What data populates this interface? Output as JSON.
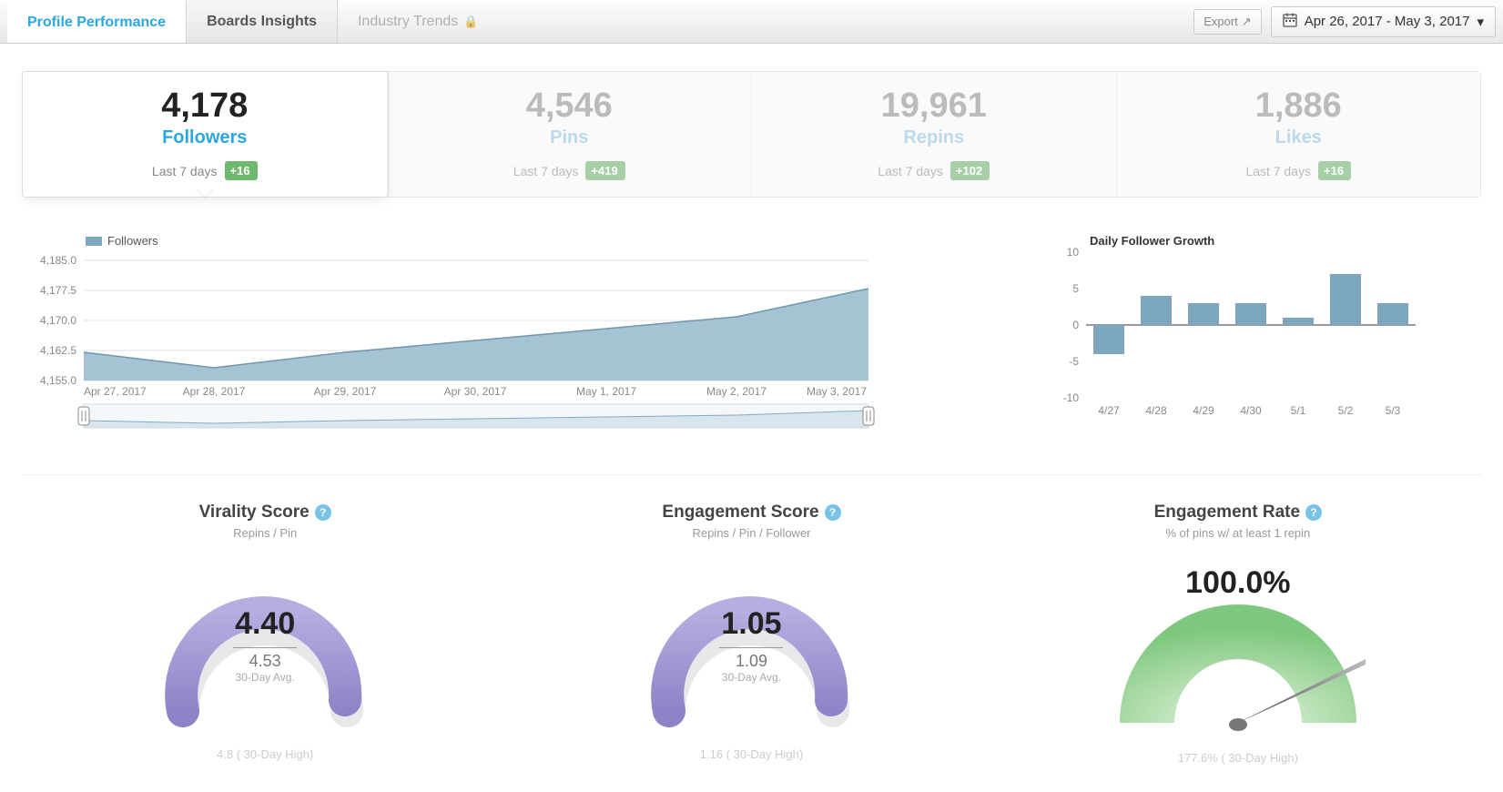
{
  "tabs": {
    "profile": "Profile Performance",
    "boards": "Boards Insights",
    "industry": "Industry Trends"
  },
  "export_label": "Export",
  "date_range": "Apr 26, 2017 - May 3, 2017",
  "stats": {
    "followers": {
      "value": "4,178",
      "label": "Followers",
      "sub": "Last 7 days",
      "delta": "+16"
    },
    "pins": {
      "value": "4,546",
      "label": "Pins",
      "sub": "Last 7 days",
      "delta": "+419"
    },
    "repins": {
      "value": "19,961",
      "label": "Repins",
      "sub": "Last 7 days",
      "delta": "+102"
    },
    "likes": {
      "value": "1,886",
      "label": "Likes",
      "sub": "Last 7 days",
      "delta": "+16"
    }
  },
  "main_chart": {
    "legend": "Followers",
    "y_ticks": [
      "4,185.0",
      "4,177.5",
      "4,170.0",
      "4,162.5",
      "4,155.0"
    ],
    "x_ticks": [
      "Apr 27, 2017",
      "Apr 28, 2017",
      "Apr 29, 2017",
      "Apr 30, 2017",
      "May 1, 2017",
      "May 2, 2017",
      "May 3, 2017"
    ]
  },
  "side_chart": {
    "title": "Daily Follower Growth",
    "y_ticks": [
      "10",
      "5",
      "0",
      "-5",
      "-10"
    ],
    "x_ticks": [
      "4/27",
      "4/28",
      "4/29",
      "4/30",
      "5/1",
      "5/2",
      "5/3"
    ]
  },
  "gauges": {
    "virality": {
      "title": "Virality Score",
      "subtitle": "Repins / Pin",
      "value": "4.40",
      "avg": "4.53",
      "avg_label": "30-Day Avg.",
      "footer": "4.8 ( 30-Day High)"
    },
    "engagement": {
      "title": "Engagement Score",
      "subtitle": "Repins / Pin / Follower",
      "value": "1.05",
      "avg": "1.09",
      "avg_label": "30-Day Avg.",
      "footer": "1.16 ( 30-Day High)"
    },
    "rate": {
      "title": "Engagement Rate",
      "subtitle": "% of pins w/ at least 1 repin",
      "value": "100.0%",
      "footer": "177.6% ( 30-Day High)"
    }
  },
  "chart_data": [
    {
      "type": "area",
      "title": "Followers",
      "x": [
        "Apr 27, 2017",
        "Apr 28, 2017",
        "Apr 29, 2017",
        "Apr 30, 2017",
        "May 1, 2017",
        "May 2, 2017",
        "May 3, 2017"
      ],
      "series": [
        {
          "name": "Followers",
          "values": [
            4162,
            4158,
            4162,
            4165,
            4168,
            4171,
            4178
          ]
        }
      ],
      "ylim": [
        4155,
        4185
      ],
      "xlabel": "",
      "ylabel": ""
    },
    {
      "type": "bar",
      "title": "Daily Follower Growth",
      "categories": [
        "4/27",
        "4/28",
        "4/29",
        "4/30",
        "5/1",
        "5/2",
        "5/3"
      ],
      "values": [
        -4,
        4,
        3,
        3,
        1,
        7,
        3
      ],
      "ylim": [
        -10,
        10
      ],
      "xlabel": "",
      "ylabel": ""
    }
  ]
}
